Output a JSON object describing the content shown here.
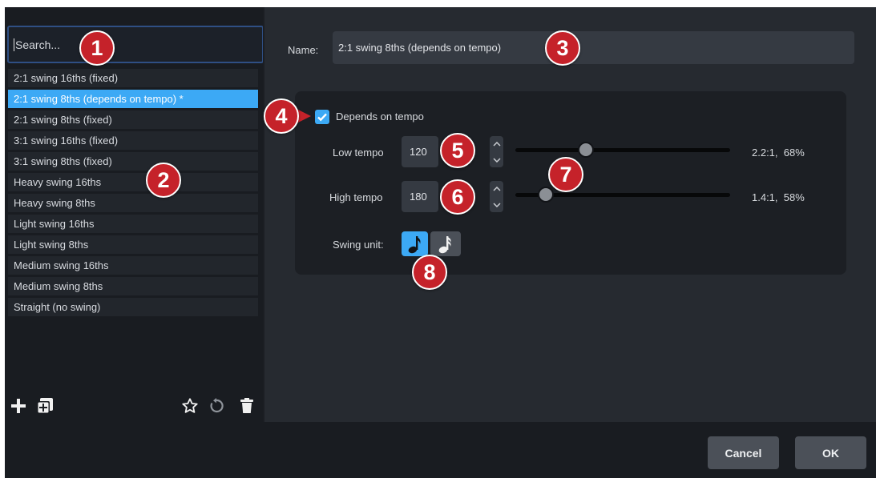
{
  "sidebar": {
    "search_placeholder": "Search...",
    "items": [
      {
        "label": "2:1 swing 16ths (fixed)",
        "selected": false
      },
      {
        "label": "2:1 swing 8ths (depends on tempo) *",
        "selected": true
      },
      {
        "label": "2:1 swing 8ths (fixed)",
        "selected": false
      },
      {
        "label": "3:1 swing 16ths (fixed)",
        "selected": false
      },
      {
        "label": "3:1 swing 8ths (fixed)",
        "selected": false
      },
      {
        "label": "Heavy swing 16ths",
        "selected": false
      },
      {
        "label": "Heavy swing 8ths",
        "selected": false
      },
      {
        "label": "Light swing 16ths",
        "selected": false
      },
      {
        "label": "Light swing 8ths",
        "selected": false
      },
      {
        "label": "Medium swing 16ths",
        "selected": false
      },
      {
        "label": "Medium swing 8ths",
        "selected": false
      },
      {
        "label": "Straight (no swing)",
        "selected": false
      }
    ],
    "toolbar_icons": [
      "add-icon",
      "duplicate-icon",
      "star-icon",
      "revert-icon",
      "trash-icon"
    ]
  },
  "editor": {
    "name_label": "Name:",
    "name_value": "2:1 swing 8ths (depends on tempo)",
    "depends_on_tempo_label": "Depends on tempo",
    "depends_on_tempo_checked": true,
    "low_tempo": {
      "label": "Low tempo",
      "value": "120",
      "ratio": "2.2:1,  68%",
      "slider_fraction": 0.33
    },
    "high_tempo": {
      "label": "High tempo",
      "value": "180",
      "ratio": "1.4:1,  58%",
      "slider_fraction": 0.14
    },
    "swing_unit_label": "Swing unit:",
    "swing_unit_options": [
      "eighth-note-icon",
      "sixteenth-note-icon"
    ],
    "swing_unit_selected": "eighth-note-icon"
  },
  "footer": {
    "cancel_label": "Cancel",
    "ok_label": "OK"
  },
  "markers": [
    "1",
    "2",
    "3",
    "4",
    "5",
    "6",
    "7",
    "8"
  ],
  "colors": {
    "accent": "#3ca9f5",
    "marker": "#c5222a",
    "panel_bg": "#262a30",
    "sidebar_bg": "#191c21"
  }
}
